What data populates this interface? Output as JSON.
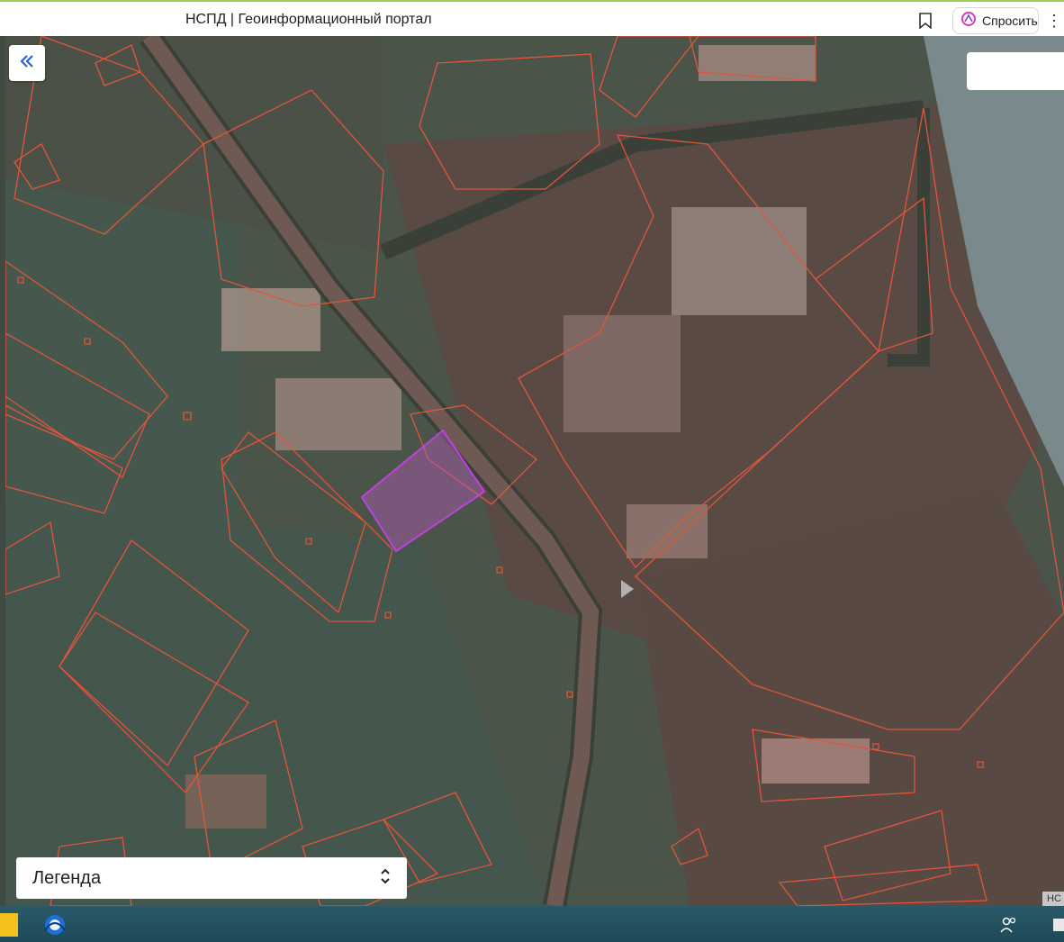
{
  "browser": {
    "page_title": "НСПД | Геоинформационный портал",
    "bookmark_icon": "bookmark-icon",
    "ask_button_label": "Спросить",
    "ask_icon": "alice-icon",
    "menu_icon": "more-vertical-icon"
  },
  "map": {
    "collapse_icon": "double-chevron-left-icon",
    "legend": {
      "label": "Легенда",
      "toggle_icon": "chevron-up-down-icon"
    },
    "badge_text": "НС",
    "colors": {
      "parcel_outline": "#e2553b",
      "selected_parcel": "#c040e0",
      "selected_fill": "#b45ab8"
    }
  },
  "taskbar": {
    "start_icon": "windows-start-icon",
    "app_icon": "browser-app-icon",
    "tray_icon": "people-icon"
  }
}
